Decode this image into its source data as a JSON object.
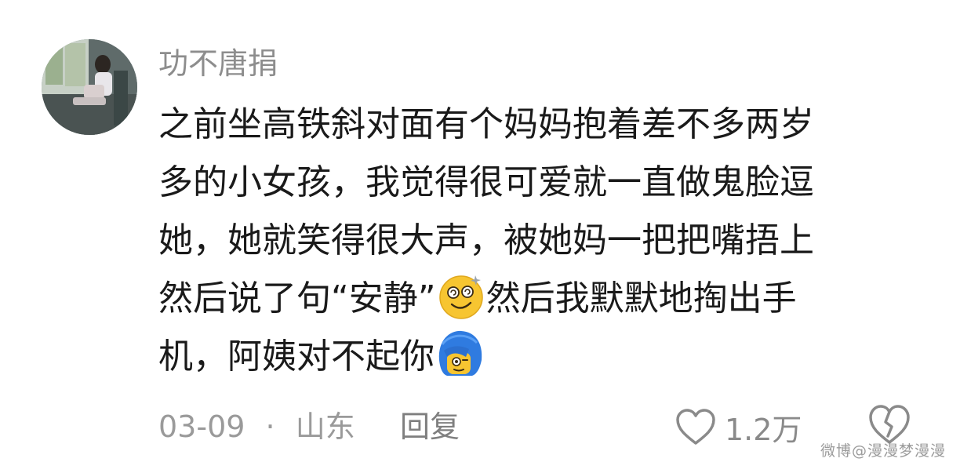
{
  "comment": {
    "author": "功不唐捐",
    "lines": [
      "之前坐高铁斜对面有个妈妈抱着差不多两岁",
      "多的小女孩，我觉得很可爱就一直做鬼脸逗",
      "她，她就笑得很大声，被她妈一把把嘴捂上",
      "然后说了句“安静”",
      "然后我默默地掏出手",
      "机，阿姨对不起你"
    ],
    "emoji_1": "dizzy-smile-emoji",
    "emoji_2": "blue-hair-face-emoji"
  },
  "footer": {
    "date": "03-09",
    "separator": "·",
    "location": "山东",
    "reply_label": "回复",
    "like_count": "1.2万"
  },
  "watermark": "微博@漫漫梦漫漫"
}
